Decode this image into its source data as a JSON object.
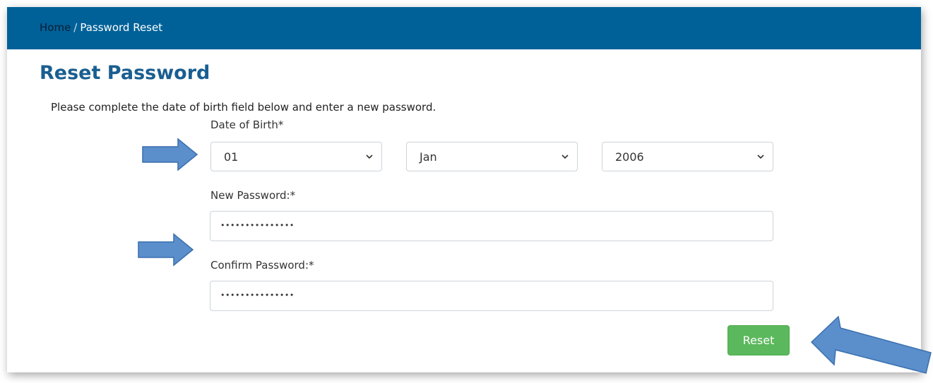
{
  "breadcrumb": {
    "home": "Home",
    "separator": "/",
    "current": "Password Reset"
  },
  "page": {
    "title": "Reset Password",
    "intro": "Please complete the date of birth field below and enter a new password."
  },
  "form": {
    "dob_label": "Date of Birth*",
    "dob_day": "01",
    "dob_month": "Jan",
    "dob_year": "2006",
    "new_password_label": "New Password:*",
    "new_password_value": "•••••••••••••••",
    "confirm_password_label": "Confirm Password:*",
    "confirm_password_value": "•••••••••••••••",
    "reset_label": "Reset"
  },
  "colors": {
    "topbar": "#006198",
    "title": "#1a5e90",
    "reset_button": "#5cb85c",
    "annotation_arrow": "#5b8fcc"
  },
  "annotations": [
    "arrow-icon",
    "arrow-icon",
    "arrow-icon"
  ]
}
